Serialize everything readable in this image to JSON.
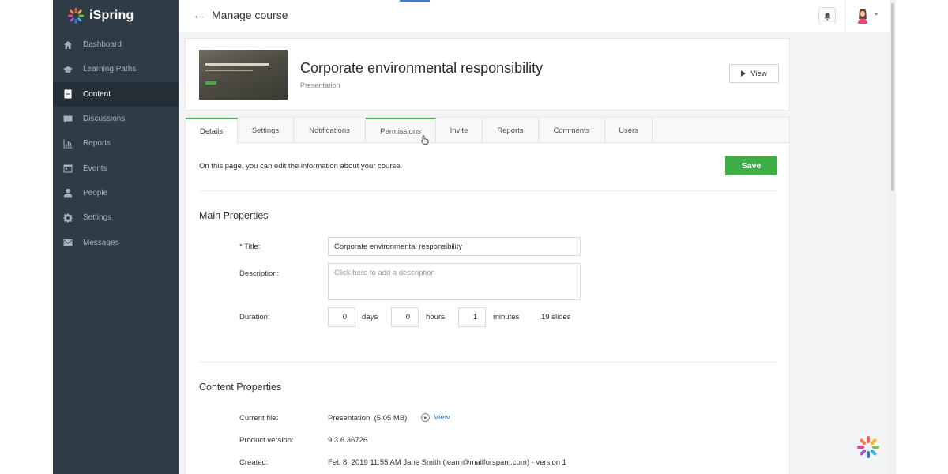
{
  "app": {
    "brand": "iSpring"
  },
  "sidebar": {
    "items": [
      {
        "label": "Dashboard",
        "icon": "home-icon"
      },
      {
        "label": "Learning Paths",
        "icon": "graduation-cap-icon"
      },
      {
        "label": "Content",
        "icon": "document-icon",
        "active": true
      },
      {
        "label": "Discussions",
        "icon": "chat-icon"
      },
      {
        "label": "Reports",
        "icon": "bar-chart-icon"
      },
      {
        "label": "Events",
        "icon": "calendar-icon"
      },
      {
        "label": "People",
        "icon": "person-icon"
      },
      {
        "label": "Settings",
        "icon": "gear-icon"
      },
      {
        "label": "Messages",
        "icon": "envelope-icon"
      }
    ]
  },
  "header": {
    "title": "Manage course",
    "back_icon": "arrow-left-icon",
    "bell_icon": "bell-icon",
    "avatar_icon": "user-avatar-icon"
  },
  "course": {
    "title": "Corporate environmental responsibility",
    "type": "Presentation",
    "view_label": "View"
  },
  "tabs": [
    {
      "label": "Details",
      "active": true
    },
    {
      "label": "Settings"
    },
    {
      "label": "Notifications"
    },
    {
      "label": "Permissions",
      "hovered": true
    },
    {
      "label": "Invite"
    },
    {
      "label": "Reports"
    },
    {
      "label": "Comments"
    },
    {
      "label": "Users"
    }
  ],
  "details": {
    "intro": "On this page, you can edit the information about your course.",
    "save_label": "Save",
    "main_properties": {
      "heading": "Main Properties",
      "title_label": "* Title:",
      "title_value": "Corporate environmental responsibility",
      "description_label": "Description:",
      "description_placeholder": "Click here to add a description",
      "duration_label": "Duration:",
      "days_value": "0",
      "days_unit": "days",
      "hours_value": "0",
      "hours_unit": "hours",
      "minutes_value": "1",
      "minutes_unit": "minutes",
      "slides": "19 slides"
    },
    "content_properties": {
      "heading": "Content Properties",
      "current_file_label": "Current file:",
      "current_file_value": "Presentation  (5.05 MB)",
      "view_link": "View",
      "product_version_label": "Product version:",
      "product_version_value": "9.3.6.36726",
      "created_label": "Created:",
      "created_value": "Feb 8, 2019 11:55 AM Jane Smith (learn@mailforspam.com) - version 1"
    }
  },
  "colors": {
    "sidebar_bg": "#2f3b45",
    "accent_green": "#3fae49",
    "link_blue": "#2a72c7"
  }
}
